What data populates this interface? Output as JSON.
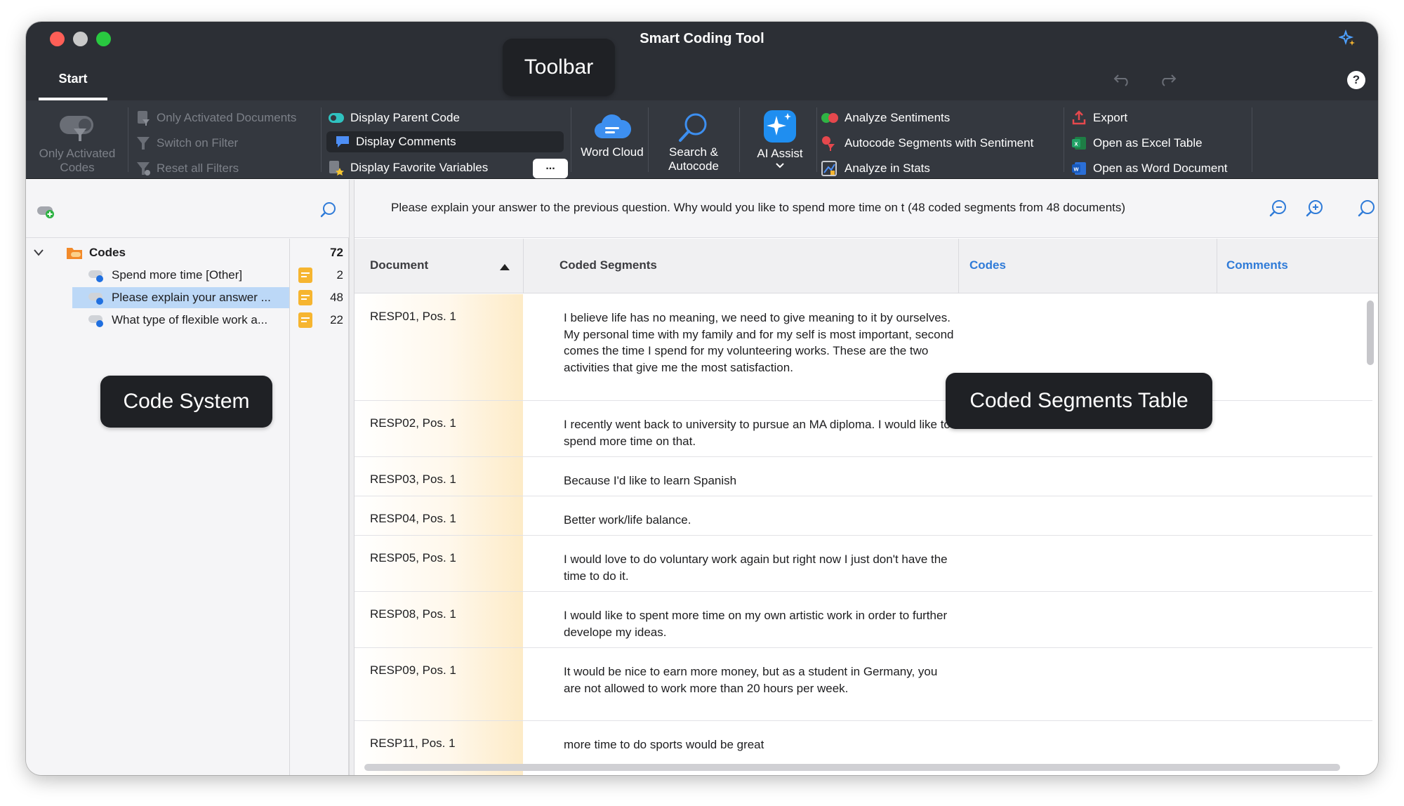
{
  "window": {
    "title": "Smart Coding Tool"
  },
  "tabs": [
    {
      "label": "Start",
      "active": true
    }
  ],
  "ribbon": {
    "only_activated_codes": "Only Activated Codes",
    "filters": {
      "only_activated_documents": "Only Activated Documents",
      "switch_on_filter": "Switch on Filter",
      "reset_all_filters": "Reset all Filters"
    },
    "display": {
      "parent_code": "Display Parent Code",
      "comments": "Display Comments",
      "favorite_variables": "Display Favorite Variables",
      "more": "..."
    },
    "word_cloud": "Word Cloud",
    "search_autocode": "Search & Autocode",
    "ai_assist": "AI Assist",
    "analysis": {
      "analyze_sentiments": "Analyze Sentiments",
      "autocode_sentiment": "Autocode Segments with Sentiment",
      "analyze_in_stats": "Analyze in Stats"
    },
    "export_group": {
      "export": "Export",
      "open_excel": "Open as Excel Table",
      "open_word": "Open as Word Document"
    }
  },
  "code_system": {
    "root": {
      "label": "Codes",
      "count": "72"
    },
    "items": [
      {
        "label": "Spend more time [Other]",
        "count": "2",
        "selected": false
      },
      {
        "label": "Please explain your answer ...",
        "count": "48",
        "selected": true
      },
      {
        "label": "What type of flexible work a...",
        "count": "22",
        "selected": false
      }
    ]
  },
  "segments_panel": {
    "query": "Please explain your answer to the previous question. Why would you like to spend more time on t (48 coded segments from 48 documents)",
    "columns": {
      "document": "Document",
      "coded_segments": "Coded Segments",
      "codes": "Codes",
      "comments": "Comments"
    },
    "rows": [
      {
        "document": "RESP01, Pos. 1",
        "segment": "I believe life has no meaning, we need to give meaning to it by ourselves. My personal time with my family and for my self is most important, second comes the time I spend for my volunteering works. These are the two activities that give me the most satisfaction."
      },
      {
        "document": "RESP02, Pos. 1",
        "segment": "I recently went back to university to pursue an MA diploma. I would like to spend more time on that."
      },
      {
        "document": "RESP03, Pos. 1",
        "segment": "Because I'd like to learn Spanish"
      },
      {
        "document": "RESP04, Pos. 1",
        "segment": "Better work/life balance."
      },
      {
        "document": "RESP05, Pos. 1",
        "segment": "I would love to do voluntary work again but right now I just don't have the time to do it."
      },
      {
        "document": "RESP08, Pos. 1",
        "segment": "I would like to spent more time on my own artistic work in order to further develope my ideas."
      },
      {
        "document": "RESP09, Pos. 1",
        "segment": "It would be nice to earn more money, but as a student in Germany, you are not allowed to work more than 20 hours per week."
      },
      {
        "document": "RESP11, Pos. 1",
        "segment": "more time to do sports would be great"
      }
    ]
  },
  "callouts": {
    "toolbar": "Toolbar",
    "code_system": "Code System",
    "coded_segments_table": "Coded Segments Table"
  }
}
